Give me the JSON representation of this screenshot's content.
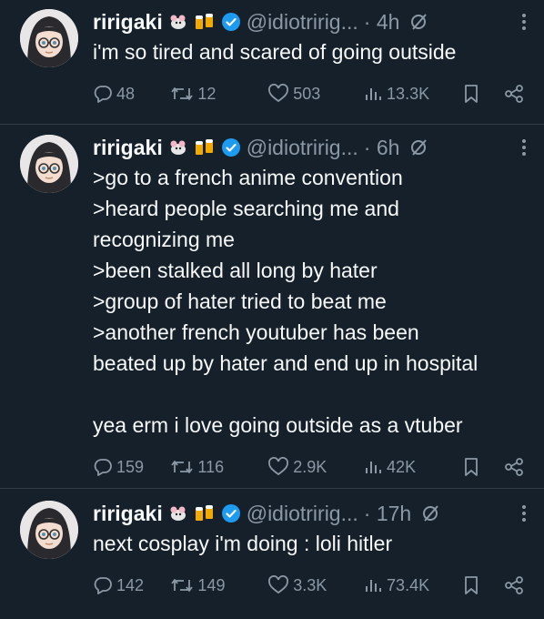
{
  "tweets": [
    {
      "name": "ririgaki",
      "handle": "@idiotririg...",
      "time": "· 4h",
      "text": "i'm so tired and scared of going outside",
      "replies": "48",
      "retweets": "12",
      "likes": "503",
      "views": "13.3K"
    },
    {
      "name": "ririgaki",
      "handle": "@idiotririg...",
      "time": "· 6h",
      "text": ">go to a french anime convention\n>heard people searching me and\nrecognizing me\n>been stalked all long by hater\n>group of hater tried to beat me\n>another french youtuber has been\nbeated up by hater and end up in hospital\n\nyea erm i love going outside as a vtuber",
      "replies": "159",
      "retweets": "116",
      "likes": "2.9K",
      "views": "42K"
    },
    {
      "name": "ririgaki",
      "handle": "@idiotririg...",
      "time": "· 17h",
      "text": "next cosplay i'm doing : loli hitler",
      "replies": "142",
      "retweets": "149",
      "likes": "3.3K",
      "views": "73.4K"
    }
  ],
  "icons": {
    "badge_emojis": [
      "rat-icon",
      "beer-mugs-icon"
    ],
    "verified": "verified-badge-icon",
    "edit": "edited-icon",
    "more": "more-vertical-icon",
    "reply": "reply-icon",
    "retweet": "retweet-icon",
    "like": "heart-icon",
    "views": "views-chart-icon",
    "bookmark": "bookmark-icon",
    "share": "share-icon"
  },
  "colors": {
    "background": "#15202b",
    "text": "#f7f9f9",
    "muted": "#8b98a5",
    "verified": "#1d9bf0",
    "divider": "#2f3b47"
  }
}
